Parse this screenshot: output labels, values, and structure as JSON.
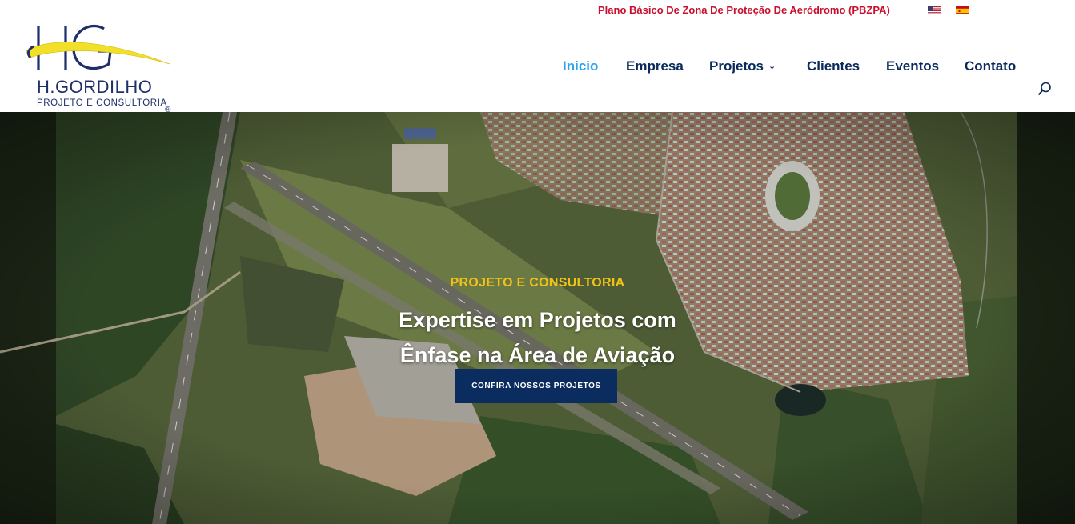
{
  "topbar": {
    "link_label": "Plano Básico De Zona De Proteção De Aeródromo (PBZPA)",
    "languages": [
      {
        "icon": "us-flag-icon"
      },
      {
        "icon": "es-flag-icon"
      }
    ]
  },
  "logo": {
    "monogram": "HG",
    "name": "H.GORDILHO",
    "tagline": "PROJETO E CONSULTORIA",
    "registered": "®"
  },
  "nav": {
    "items": [
      {
        "label": "Inicio",
        "active": true
      },
      {
        "label": "Empresa"
      },
      {
        "label": "Projetos",
        "has_dropdown": true
      },
      {
        "label": "Clientes"
      },
      {
        "label": "Eventos"
      },
      {
        "label": "Contato"
      }
    ],
    "search_icon": "search-icon"
  },
  "hero": {
    "eyebrow": "PROJETO E CONSULTORIA",
    "title_line1": "Expertise em Projetos com",
    "title_line2": "Ênfase na Área de Aviação",
    "button_label": "CONFIRA NOSSOS PROJETOS"
  },
  "colors": {
    "accent_red": "#c8102e",
    "nav_text": "#0a2a5c",
    "nav_active": "#2ea3f2",
    "eyebrow_yellow": "#f2c316",
    "button_bg": "#0b2c5f"
  }
}
